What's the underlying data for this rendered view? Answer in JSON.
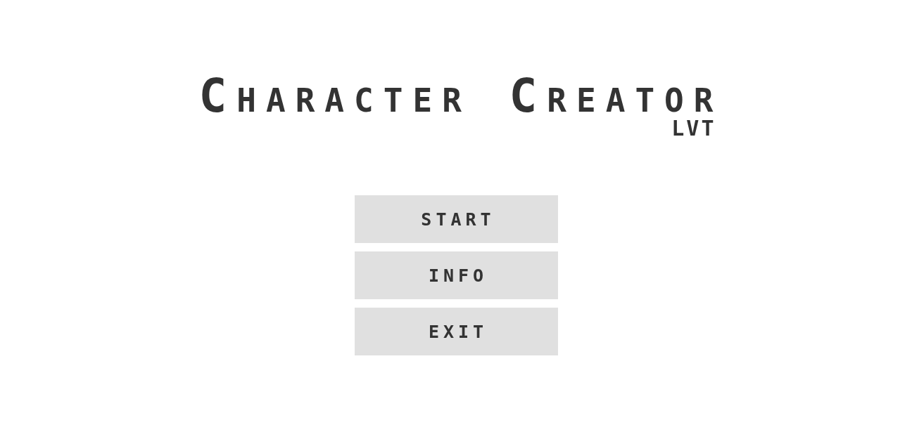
{
  "title": "Character Creator",
  "subtitle": "LVT",
  "menu": [
    {
      "label": "START"
    },
    {
      "label": "INFO"
    },
    {
      "label": "EXIT"
    }
  ]
}
